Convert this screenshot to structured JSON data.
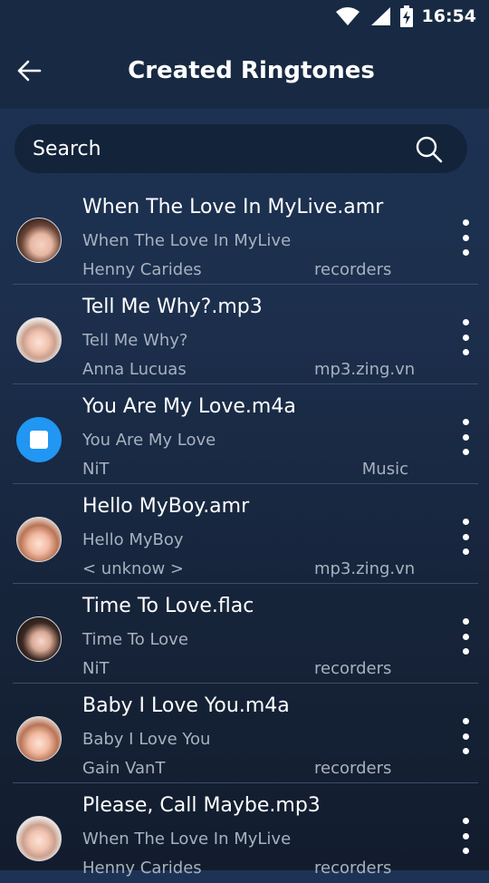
{
  "status_bar": {
    "time": "16:54",
    "icons": [
      "wifi-icon",
      "signal-icon",
      "battery-charging-icon"
    ]
  },
  "header": {
    "title": "Created Ringtones",
    "back_icon": "arrow-left-icon"
  },
  "search": {
    "placeholder": "Search",
    "icon": "search-icon"
  },
  "colors": {
    "background_top": "#1d3355",
    "background_bottom": "#121c2d",
    "search_bg": "#13233a",
    "secondary_text": "#a7b1bf",
    "divider": "#3b4d66",
    "file_icon": "#2196f3"
  },
  "ringtones": [
    {
      "title": "When The Love In MyLive.amr",
      "song": "When The Love In MyLive",
      "artist": "Henny Carides",
      "source": "recorders",
      "avatar": "photo"
    },
    {
      "title": "Tell Me Why?.mp3",
      "song": "Tell Me Why?",
      "artist": "Anna Lucuas",
      "source": "mp3.zing.vn",
      "avatar": "photo"
    },
    {
      "title": "You Are My Love.m4a",
      "song": "You Are My Love",
      "artist": "NiT",
      "source": "Music",
      "avatar": "file"
    },
    {
      "title": "Hello MyBoy.amr",
      "song": "Hello MyBoy",
      "artist": "< unknow >",
      "source": "mp3.zing.vn",
      "avatar": "photo"
    },
    {
      "title": "Time To Love.flac",
      "song": "Time To Love",
      "artist": "NiT",
      "source": "recorders",
      "avatar": "photo"
    },
    {
      "title": "Baby I Love You.m4a",
      "song": "Baby I Love You",
      "artist": "Gain VanT",
      "source": "recorders",
      "avatar": "photo"
    },
    {
      "title": "Please, Call Maybe.mp3",
      "song": "When The Love In MyLive",
      "artist": "Henny Carides",
      "source": "recorders",
      "avatar": "photo"
    }
  ],
  "row_menu_icon": "more-vertical-icon"
}
